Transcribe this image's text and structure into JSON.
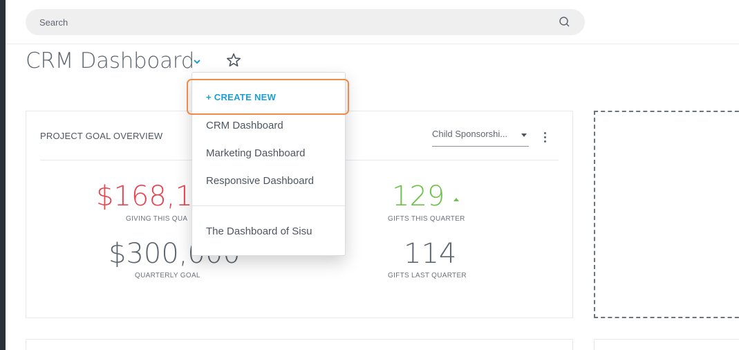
{
  "search": {
    "placeholder": "Search"
  },
  "page": {
    "title": "CRM Dashboard"
  },
  "card": {
    "title": "PROJECT GOAL OVERVIEW",
    "filter_value": "Child Sponsorshi...",
    "metrics": [
      {
        "value": "$168,15",
        "label": "GIVING THIS QUA",
        "color": "#e8434f"
      },
      {
        "value": "$300,000",
        "label": "QUARTERLY GOAL",
        "color": "#5d6670"
      },
      {
        "value": "129",
        "label": "GIFTS THIS QUARTER",
        "color": "#6cc24a"
      },
      {
        "value": "114",
        "label": "GIFTS LAST QUARTER",
        "color": "#5d6670"
      }
    ]
  },
  "dropdown": {
    "create_label": "+ CREATE NEW",
    "items": [
      "CRM Dashboard",
      "Marketing Dashboard",
      "Responsive Dashboard",
      "The Dashboard of Sisu"
    ]
  },
  "colors": {
    "accent": "#1a9fd6",
    "highlight": "#f08a4a",
    "up_arrow": "#6cc24a"
  }
}
